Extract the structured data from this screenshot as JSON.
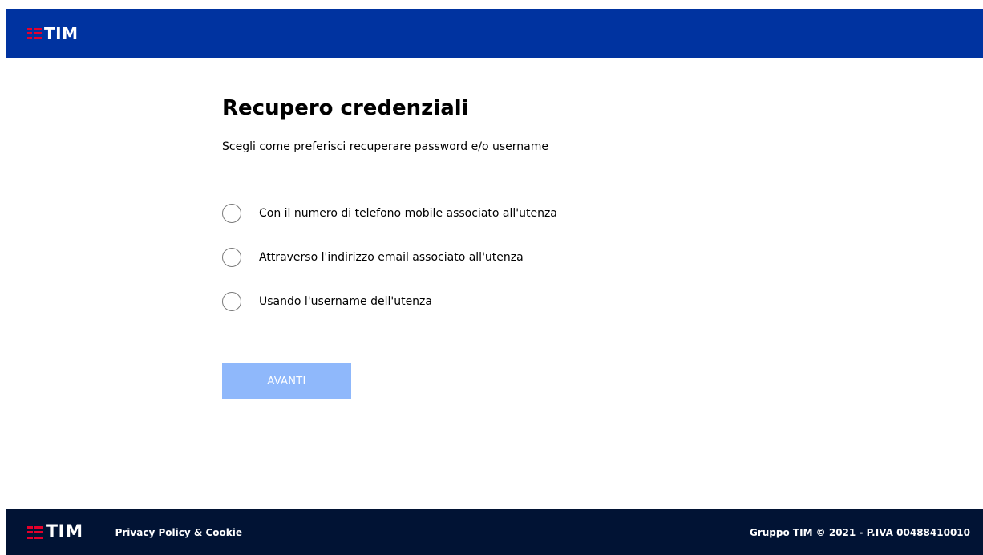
{
  "header": {
    "logo_text": "TIM"
  },
  "main": {
    "title": "Recupero credenziali",
    "subtitle": "Scegli come preferisci recuperare password e/o username",
    "options": [
      {
        "label": "Con il numero di telefono mobile associato all'utenza",
        "selected": false
      },
      {
        "label": "Attraverso l'indirizzo email associato all'utenza",
        "selected": false
      },
      {
        "label": "Usando l'username dell'utenza",
        "selected": false
      }
    ],
    "next_label": "AVANTI",
    "next_disabled": true
  },
  "footer": {
    "logo_text": "TIM",
    "privacy_link": "Privacy Policy & Cookie",
    "copyright": "Gruppo TIM © 2021 - P.IVA 00488410010"
  },
  "colors": {
    "header_bg": "#0033a0",
    "footer_bg": "#011334",
    "logo_red": "#e4002b",
    "button_disabled_bg": "#8fb8fb"
  },
  "icons": {
    "logo_mark": "tim-stripes-logo-icon",
    "radio": "radio-unchecked-icon"
  }
}
